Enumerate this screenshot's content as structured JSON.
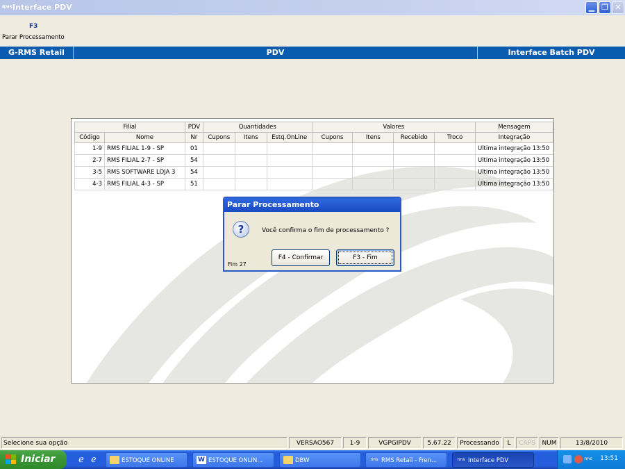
{
  "window": {
    "title": "Interface PDV",
    "app_icon": "RMS",
    "controls": [
      "minimize-icon",
      "maximize-icon",
      "close-icon"
    ]
  },
  "hotkey": {
    "key": "F3",
    "label": "Parar Processamento"
  },
  "header": {
    "left": "G-RMS Retail",
    "center": "PDV",
    "right": "Interface Batch PDV"
  },
  "grid": {
    "groups": [
      "Filial",
      "PDV",
      "Quantidades",
      "Valores",
      "Mensagem"
    ],
    "columns": [
      "Código",
      "Nome",
      "Nr",
      "Cupons",
      "Itens",
      "Estq.OnLine",
      "Cupons",
      "Itens",
      "Recebido",
      "Troco",
      "Integração"
    ],
    "rows": [
      [
        "1-9",
        "RMS FILIAL 1-9 - SP",
        "01",
        "",
        "",
        "",
        "",
        "",
        "",
        "",
        "Ultima integração 13:50"
      ],
      [
        "2-7",
        "RMS FILIAL 2-7 - SP",
        "54",
        "",
        "",
        "",
        "",
        "",
        "",
        "",
        "Ultima integração 13:50"
      ],
      [
        "3-5",
        "RMS SOFTWARE LOJA 3",
        "54",
        "",
        "",
        "",
        "",
        "",
        "",
        "",
        "Ultima integração 13:50"
      ],
      [
        "4-3",
        "RMS FILIAL 4-3 - SP",
        "51",
        "",
        "",
        "",
        "",
        "",
        "",
        "",
        "Ultima integração 13:50"
      ]
    ]
  },
  "dialog": {
    "title": "Parar Processamento",
    "icon": "question-icon",
    "message": "Você confirma o fim de processamento ?",
    "confirm_label": "F4 - Confirmar",
    "end_label": "F3 - Fim",
    "footer": "Fim 27"
  },
  "statusbar": {
    "message": "Selecione sua opção",
    "version": "VERSAO567",
    "branch": "1-9",
    "program": "VGPGIPDV",
    "build": "5.67.22",
    "state": "Processando",
    "l": "L",
    "caps": "CAPS",
    "num": "NUM",
    "date": "13/8/2010"
  },
  "taskbar": {
    "start_label": "Iniciar",
    "items": [
      {
        "label": "ESTOQUE ONLINE",
        "icon": "folder-icon"
      },
      {
        "label": "ESTOQUE ONLIN...",
        "icon": "word-doc-icon"
      },
      {
        "label": "DBW",
        "icon": "folder-icon"
      },
      {
        "label": "RMS Retail - Fren...",
        "icon": "rms-app-icon"
      },
      {
        "label": "Interface PDV",
        "icon": "rms-app-icon"
      }
    ],
    "clock": "13:51"
  },
  "colors": {
    "header_blue": "#0a5cb0",
    "dialog_title_blue": "#1a4bc2",
    "taskbar_blue": "#245edc",
    "start_green": "#3c9a37",
    "background": "#f0ebdf"
  }
}
